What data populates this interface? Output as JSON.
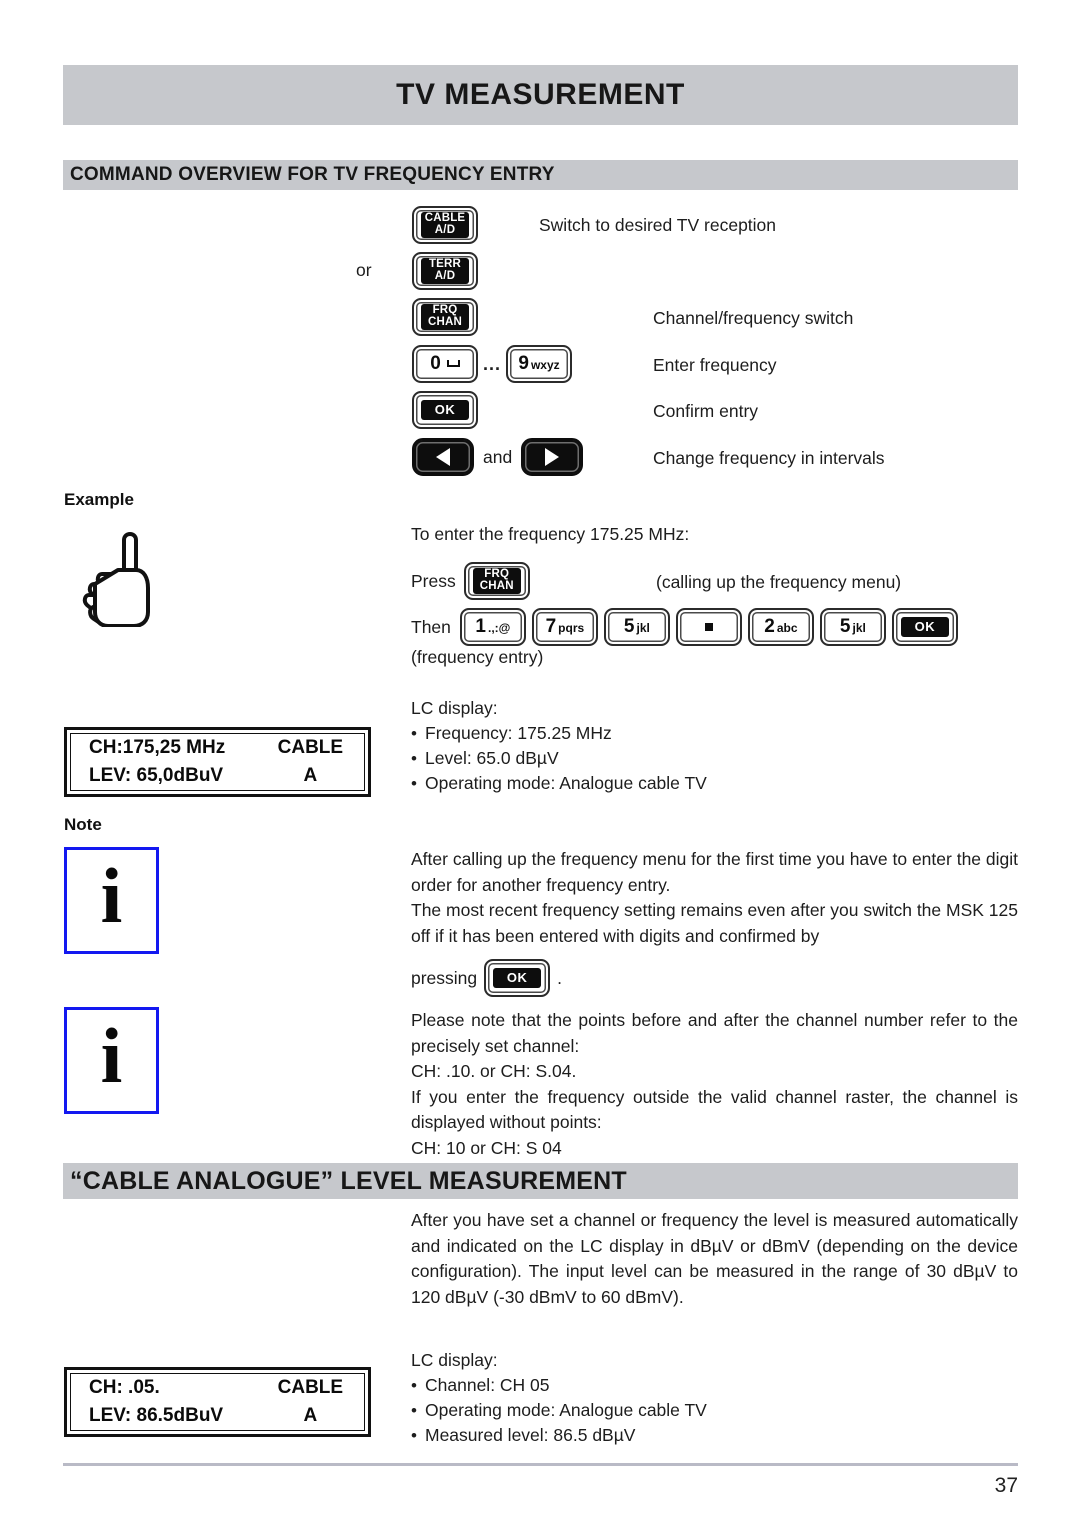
{
  "document": {
    "page_title": "TV MEASUREMENT",
    "page_number": "37"
  },
  "sections": {
    "command_overview": {
      "heading": "COMMAND OVERVIEW FOR TV FREQUENCY ENTRY",
      "or_label": "or",
      "and_label": "and",
      "ellipsis": "...",
      "rows": [
        {
          "key_top": "CABLE",
          "key_bottom": "A/D",
          "description": "Switch to desired TV reception"
        },
        {
          "key_top": "TERR",
          "key_bottom": "A/D",
          "description": ""
        },
        {
          "key_top": "FRQ",
          "key_bottom": "CHAN",
          "description": "Channel/frequency switch"
        },
        {
          "key_digit_from": "0",
          "key_digit_to": "9",
          "key_sub_to": "wxyz",
          "description": "Enter frequency"
        },
        {
          "key_label": "OK",
          "description": "Confirm entry"
        },
        {
          "key_left": "left-arrow",
          "key_right": "right-arrow",
          "description": "Change frequency in intervals"
        }
      ]
    },
    "example": {
      "label": "Example",
      "intro": "To enter the frequency 175.25 MHz:",
      "press_label": "Press",
      "press_key_top": "FRQ",
      "press_key_bottom": "CHAN",
      "press_note": "(calling up the frequency menu)",
      "then_label": "Then",
      "then_keys": [
        {
          "digit": "1",
          "sub": ".,:@"
        },
        {
          "digit": "7",
          "sub": "pqrs"
        },
        {
          "digit": "5",
          "sub": "jkl"
        },
        {
          "digit": ".",
          "sub": ""
        },
        {
          "digit": "2",
          "sub": "abc"
        },
        {
          "digit": "5",
          "sub": "jkl"
        },
        {
          "digit": "OK",
          "sub": ""
        }
      ],
      "then_note": "(frequency entry)",
      "lc_display_label": "LC display:",
      "lc_display_bullets": [
        "Frequency: 175.25 MHz",
        "Level: 65.0 dBµV",
        "Operating mode: Analogue cable TV"
      ],
      "lcd": {
        "line1_left": "CH:175,25 MHz",
        "line1_right": "CABLE",
        "line2_left": "LEV: 65,0dBuV",
        "line2_right": "A"
      }
    },
    "note": {
      "label": "Note",
      "note1": {
        "icon": "info-icon",
        "paragraphs": [
          "After calling up the frequency menu for the first time you have to enter the digit order for another frequency entry.",
          "The most recent frequency setting remains even after you switch the MSK 125 off if it has been entered with digits and confirmed by"
        ],
        "pressing_label": "pressing",
        "pressing_key": "OK",
        "pressing_period": "."
      },
      "note2": {
        "icon": "info-icon",
        "paragraphs": [
          "Please note that the points before and after the channel number refer to the precisely set channel:",
          "CH: .10.  or  CH: S.04.",
          "If you enter the frequency outside the valid channel raster, the channel is displayed without points:",
          "CH:  10   or  CH: S 04"
        ]
      }
    },
    "cable_analogue": {
      "heading": "“CABLE ANALOGUE” LEVEL MEASUREMENT",
      "body": "After you have set a channel or frequency the level is measured automatically and indicated on the LC display in dBµV or dBmV (depending on the device configuration). The input level can be measured in the range of 30 dBµV to 120 dBµV (-30 dBmV to 60 dBmV).",
      "lc_display_label": "LC display:",
      "lc_display_bullets": [
        "Channel: CH 05",
        "Operating mode: Analogue cable TV",
        "Measured level: 86.5 dBµV"
      ],
      "lcd": {
        "line1_left": "CH: .05.",
        "line1_right": "CABLE",
        "line2_left": "LEV: 86.5dBuV",
        "line2_right": "A"
      }
    }
  },
  "colors": {
    "banner_gray": "#c6c8cc",
    "info_border_blue": "#1318f0",
    "footer_rule": "#b9bac6"
  }
}
